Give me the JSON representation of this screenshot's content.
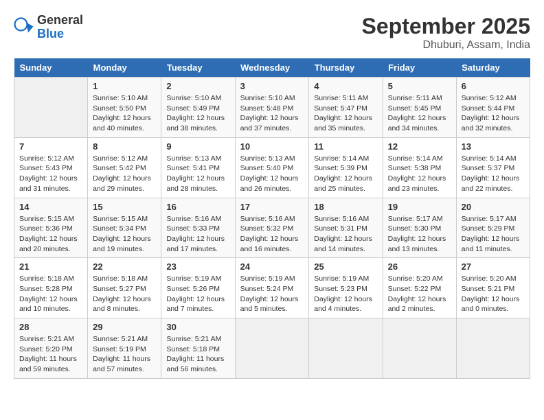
{
  "header": {
    "logo_general": "General",
    "logo_blue": "Blue",
    "month_title": "September 2025",
    "location": "Dhuburi, Assam, India"
  },
  "weekdays": [
    "Sunday",
    "Monday",
    "Tuesday",
    "Wednesday",
    "Thursday",
    "Friday",
    "Saturday"
  ],
  "weeks": [
    [
      {
        "day": "",
        "info": ""
      },
      {
        "day": "1",
        "info": "Sunrise: 5:10 AM\nSunset: 5:50 PM\nDaylight: 12 hours\nand 40 minutes."
      },
      {
        "day": "2",
        "info": "Sunrise: 5:10 AM\nSunset: 5:49 PM\nDaylight: 12 hours\nand 38 minutes."
      },
      {
        "day": "3",
        "info": "Sunrise: 5:10 AM\nSunset: 5:48 PM\nDaylight: 12 hours\nand 37 minutes."
      },
      {
        "day": "4",
        "info": "Sunrise: 5:11 AM\nSunset: 5:47 PM\nDaylight: 12 hours\nand 35 minutes."
      },
      {
        "day": "5",
        "info": "Sunrise: 5:11 AM\nSunset: 5:45 PM\nDaylight: 12 hours\nand 34 minutes."
      },
      {
        "day": "6",
        "info": "Sunrise: 5:12 AM\nSunset: 5:44 PM\nDaylight: 12 hours\nand 32 minutes."
      }
    ],
    [
      {
        "day": "7",
        "info": "Sunrise: 5:12 AM\nSunset: 5:43 PM\nDaylight: 12 hours\nand 31 minutes."
      },
      {
        "day": "8",
        "info": "Sunrise: 5:12 AM\nSunset: 5:42 PM\nDaylight: 12 hours\nand 29 minutes."
      },
      {
        "day": "9",
        "info": "Sunrise: 5:13 AM\nSunset: 5:41 PM\nDaylight: 12 hours\nand 28 minutes."
      },
      {
        "day": "10",
        "info": "Sunrise: 5:13 AM\nSunset: 5:40 PM\nDaylight: 12 hours\nand 26 minutes."
      },
      {
        "day": "11",
        "info": "Sunrise: 5:14 AM\nSunset: 5:39 PM\nDaylight: 12 hours\nand 25 minutes."
      },
      {
        "day": "12",
        "info": "Sunrise: 5:14 AM\nSunset: 5:38 PM\nDaylight: 12 hours\nand 23 minutes."
      },
      {
        "day": "13",
        "info": "Sunrise: 5:14 AM\nSunset: 5:37 PM\nDaylight: 12 hours\nand 22 minutes."
      }
    ],
    [
      {
        "day": "14",
        "info": "Sunrise: 5:15 AM\nSunset: 5:36 PM\nDaylight: 12 hours\nand 20 minutes."
      },
      {
        "day": "15",
        "info": "Sunrise: 5:15 AM\nSunset: 5:34 PM\nDaylight: 12 hours\nand 19 minutes."
      },
      {
        "day": "16",
        "info": "Sunrise: 5:16 AM\nSunset: 5:33 PM\nDaylight: 12 hours\nand 17 minutes."
      },
      {
        "day": "17",
        "info": "Sunrise: 5:16 AM\nSunset: 5:32 PM\nDaylight: 12 hours\nand 16 minutes."
      },
      {
        "day": "18",
        "info": "Sunrise: 5:16 AM\nSunset: 5:31 PM\nDaylight: 12 hours\nand 14 minutes."
      },
      {
        "day": "19",
        "info": "Sunrise: 5:17 AM\nSunset: 5:30 PM\nDaylight: 12 hours\nand 13 minutes."
      },
      {
        "day": "20",
        "info": "Sunrise: 5:17 AM\nSunset: 5:29 PM\nDaylight: 12 hours\nand 11 minutes."
      }
    ],
    [
      {
        "day": "21",
        "info": "Sunrise: 5:18 AM\nSunset: 5:28 PM\nDaylight: 12 hours\nand 10 minutes."
      },
      {
        "day": "22",
        "info": "Sunrise: 5:18 AM\nSunset: 5:27 PM\nDaylight: 12 hours\nand 8 minutes."
      },
      {
        "day": "23",
        "info": "Sunrise: 5:19 AM\nSunset: 5:26 PM\nDaylight: 12 hours\nand 7 minutes."
      },
      {
        "day": "24",
        "info": "Sunrise: 5:19 AM\nSunset: 5:24 PM\nDaylight: 12 hours\nand 5 minutes."
      },
      {
        "day": "25",
        "info": "Sunrise: 5:19 AM\nSunset: 5:23 PM\nDaylight: 12 hours\nand 4 minutes."
      },
      {
        "day": "26",
        "info": "Sunrise: 5:20 AM\nSunset: 5:22 PM\nDaylight: 12 hours\nand 2 minutes."
      },
      {
        "day": "27",
        "info": "Sunrise: 5:20 AM\nSunset: 5:21 PM\nDaylight: 12 hours\nand 0 minutes."
      }
    ],
    [
      {
        "day": "28",
        "info": "Sunrise: 5:21 AM\nSunset: 5:20 PM\nDaylight: 11 hours\nand 59 minutes."
      },
      {
        "day": "29",
        "info": "Sunrise: 5:21 AM\nSunset: 5:19 PM\nDaylight: 11 hours\nand 57 minutes."
      },
      {
        "day": "30",
        "info": "Sunrise: 5:21 AM\nSunset: 5:18 PM\nDaylight: 11 hours\nand 56 minutes."
      },
      {
        "day": "",
        "info": ""
      },
      {
        "day": "",
        "info": ""
      },
      {
        "day": "",
        "info": ""
      },
      {
        "day": "",
        "info": ""
      }
    ]
  ]
}
